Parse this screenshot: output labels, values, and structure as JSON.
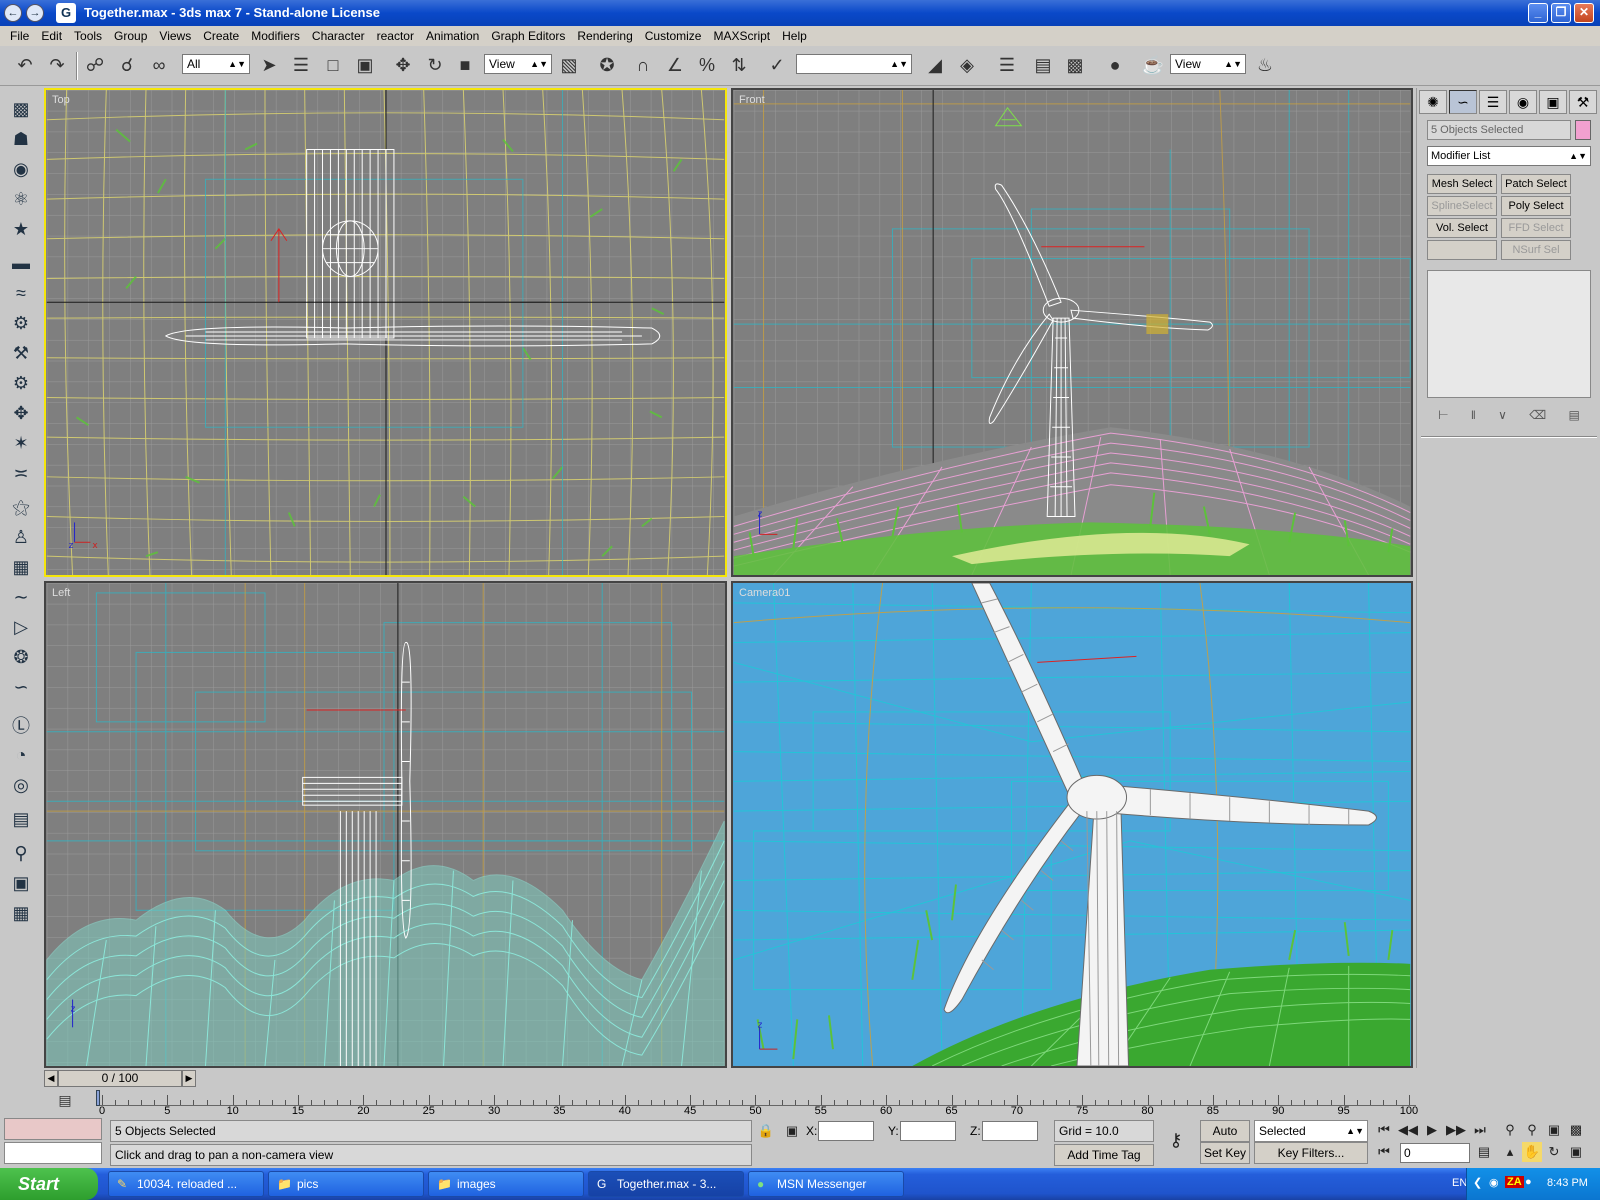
{
  "window": {
    "title": "Together.max - 3ds max 7 - Stand-alone License",
    "app_icon": "G"
  },
  "menu": [
    "File",
    "Edit",
    "Tools",
    "Group",
    "Views",
    "Create",
    "Modifiers",
    "Character",
    "reactor",
    "Animation",
    "Graph Editors",
    "Rendering",
    "Customize",
    "MAXScript",
    "Help"
  ],
  "toolbar": {
    "selection_filter": "All",
    "ref_coord": "View",
    "named_selection": "",
    "render_type": "View"
  },
  "viewports": {
    "top": "Top",
    "front": "Front",
    "left": "Left",
    "camera": "Camera01"
  },
  "cmdpanel": {
    "selection_name": "5 Objects Selected",
    "selection_color": "#f2a0d0",
    "modifier_list": "Modifier List",
    "buttons": [
      {
        "label": "Mesh Select",
        "enabled": true
      },
      {
        "label": "Patch Select",
        "enabled": true
      },
      {
        "label": "SplineSelect",
        "enabled": false
      },
      {
        "label": "Poly Select",
        "enabled": true
      },
      {
        "label": "Vol. Select",
        "enabled": true
      },
      {
        "label": "FFD Select",
        "enabled": false
      },
      {
        "label": "",
        "enabled": false
      },
      {
        "label": "NSurf Sel",
        "enabled": false
      }
    ]
  },
  "timeline": {
    "slider_label": "0 / 100",
    "ticks": [
      "0",
      "5",
      "10",
      "15",
      "20",
      "25",
      "30",
      "35",
      "40",
      "45",
      "50",
      "55",
      "60",
      "65",
      "70",
      "75",
      "80",
      "85",
      "90",
      "95",
      "100"
    ]
  },
  "status": {
    "selection": "5 Objects Selected",
    "prompt": "Click and drag to pan a non-camera view",
    "x_label": "X:",
    "y_label": "Y:",
    "z_label": "Z:",
    "grid": "Grid = 10.0",
    "add_time_tag": "Add Time Tag",
    "auto_key": "Auto Key",
    "set_key": "Set Key",
    "key_mode": "Selected",
    "key_filters": "Key Filters...",
    "frame": "0"
  },
  "taskbar": {
    "start": "Start",
    "tasks": [
      {
        "label": "10034. reloaded ...",
        "icon": "pencil-icon"
      },
      {
        "label": "pics",
        "icon": "folder-icon"
      },
      {
        "label": "images",
        "icon": "folder-icon"
      },
      {
        "label": "Together.max - 3...",
        "icon": "max-icon"
      },
      {
        "label": "MSN Messenger",
        "icon": "msn-icon"
      }
    ],
    "lang": "EN",
    "clock": "8:43 PM"
  },
  "colors": {
    "viewport_bg": "#7f7f7f",
    "camera_bg": "#4ea5d9",
    "active_border": "#f5e60a",
    "grass": "#5cc23a",
    "hill_wire": "#e8a0d4",
    "terrain_cyan": "#8ce6d8"
  }
}
